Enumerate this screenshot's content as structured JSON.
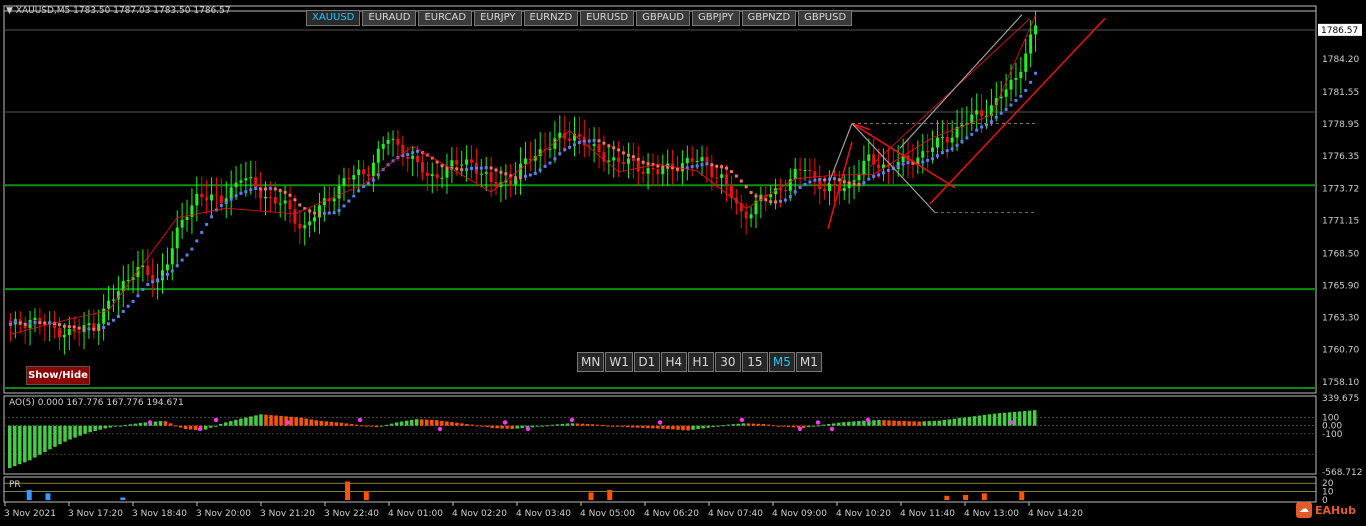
{
  "header": {
    "symbol_info": "▼ XAUUSD,M5  1783.50 1787.03 1783.50 1786.57"
  },
  "symbols": [
    "XAUUSD",
    "EURAUD",
    "EURCAD",
    "EURJPY",
    "EURNZD",
    "EURUSD",
    "GBPAUD",
    "GBPJPY",
    "GBPNZD",
    "GBPUSD"
  ],
  "active_symbol": "XAUUSD",
  "timeframes": [
    "MN",
    "W1",
    "D1",
    "H4",
    "H1",
    "30",
    "15",
    "M5",
    "M1"
  ],
  "active_timeframe": "M5",
  "show_hide_label": "Show/Hide",
  "price_axis": {
    "labels": [
      "1786.57",
      "1784.20",
      "1781.55",
      "1778.95",
      "1776.35",
      "1773.72",
      "1771.15",
      "1768.50",
      "1765.90",
      "1763.30",
      "1760.70",
      "1758.10"
    ],
    "current_price": "1786.57"
  },
  "ao_indicator": {
    "info": "AO(5) 0.000 167.776 167.776 194.671",
    "axis_labels": [
      "339.675",
      "100",
      "0.00",
      "-100",
      "-568.712"
    ]
  },
  "pr_indicator": {
    "label": "PR",
    "axis_labels": [
      "20",
      "10",
      "0"
    ]
  },
  "time_axis": {
    "labels": [
      "3 Nov 2021",
      "3 Nov 17:20",
      "3 Nov 18:40",
      "3 Nov 20:00",
      "3 Nov 21:20",
      "3 Nov 22:40",
      "4 Nov 01:00",
      "4 Nov 02:20",
      "4 Nov 03:40",
      "4 Nov 05:00",
      "4 Nov 06:20",
      "4 Nov 07:40",
      "4 Nov 09:00",
      "4 Nov 10:20",
      "4 Nov 11:40",
      "4 Nov 13:00",
      "4 Nov 14:20"
    ]
  },
  "chart_data": {
    "type": "line",
    "title": "XAUUSD,M5",
    "ohlc_last": {
      "open": 1783.5,
      "high": 1787.03,
      "low": 1783.5,
      "close": 1786.57
    },
    "price_path": [
      1762.5,
      1763.2,
      1762.4,
      1762.0,
      1762.8,
      1765.0,
      1767.5,
      1766.0,
      1770.2,
      1773.5,
      1772.5,
      1774.8,
      1773.3,
      1772.5,
      1770.5,
      1772.5,
      1774.5,
      1775.0,
      1777.8,
      1776.5,
      1774.5,
      1775.5,
      1776.0,
      1774.0,
      1774.5,
      1776.5,
      1777.5,
      1778.2,
      1776.6,
      1776.0,
      1775.5,
      1775.0,
      1775.8,
      1776.0,
      1774.5,
      1771.5,
      1773.0,
      1774.0,
      1775.5,
      1773.5,
      1774.0,
      1776.0,
      1775.5,
      1776.0,
      1777.0,
      1778.2,
      1779.5,
      1780.5,
      1782.5,
      1786.8
    ],
    "support_levels": [
      1774.0,
      1765.6
    ],
    "ao_values": [
      -520,
      -430,
      -300,
      -180,
      -90,
      -30,
      10,
      40,
      60,
      -40,
      -60,
      30,
      90,
      140,
      120,
      100,
      60,
      40,
      10,
      -20,
      40,
      80,
      70,
      40,
      10,
      -30,
      -40,
      -20,
      10,
      30,
      20,
      0,
      -20,
      -30,
      -40,
      -60,
      -30,
      10,
      30,
      20,
      -10,
      -30,
      10,
      40,
      60,
      70,
      60,
      50,
      60,
      90,
      120,
      150,
      170,
      190
    ],
    "pr_spikes": [
      0,
      12,
      8,
      0,
      0,
      0,
      3,
      0,
      0,
      0,
      0,
      0,
      0,
      0,
      0,
      0,
      0,
      0,
      22,
      10,
      0,
      0,
      0,
      0,
      0,
      0,
      0,
      0,
      0,
      0,
      0,
      9,
      12,
      0,
      0,
      0,
      0,
      0,
      0,
      0,
      0,
      0,
      0,
      0,
      0,
      0,
      0,
      0,
      0,
      0,
      5,
      6,
      8,
      0,
      10
    ]
  },
  "colors": {
    "bull": "#22ee22",
    "bear": "#ee1111",
    "ma_up": "#5b7ff0",
    "ma_down": "#f07565",
    "support": "#0f8f0f",
    "channel": "#ee1111",
    "grey_channel": "#a0a0a0",
    "ao_up": "#44cc44",
    "ao_down": "#ff5500",
    "dots": "#ff33ff"
  }
}
